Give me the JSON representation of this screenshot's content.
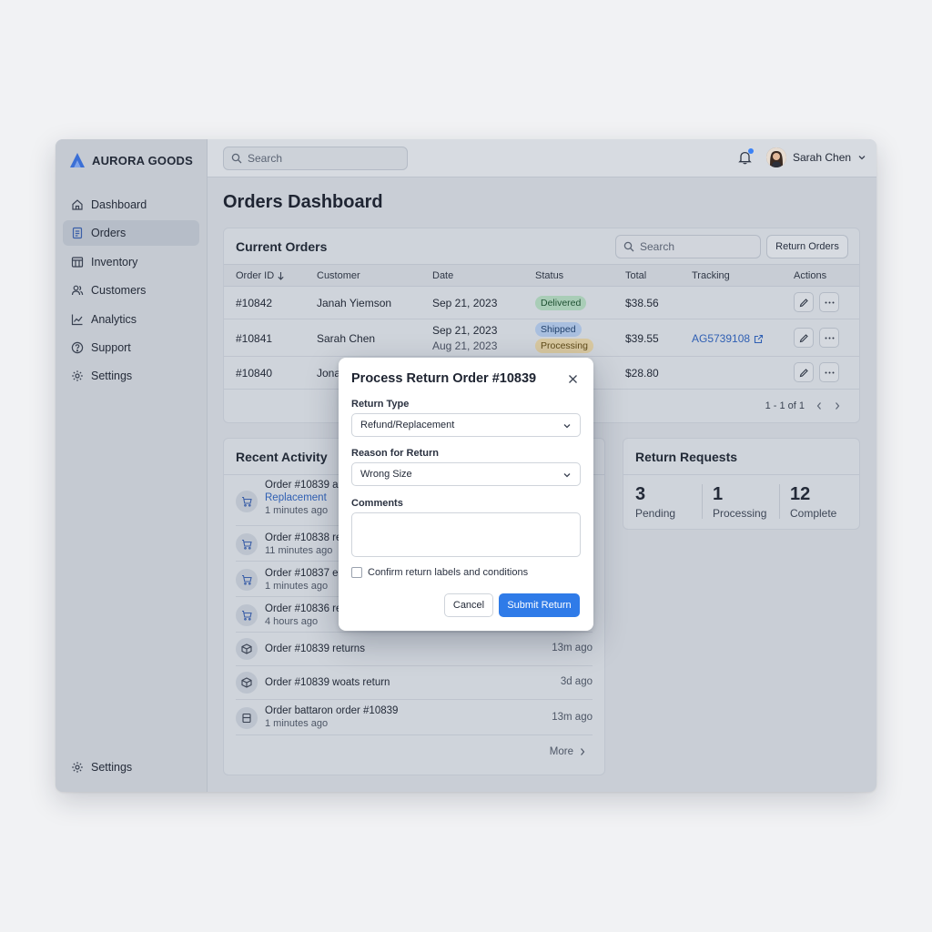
{
  "brand": {
    "name": "AURORA GOODS",
    "accent": "#3b6fd6"
  },
  "sidebar": {
    "items": [
      {
        "label": "Dashboard",
        "icon": "home-icon"
      },
      {
        "label": "Orders",
        "icon": "document-icon",
        "active": true
      },
      {
        "label": "Inventory",
        "icon": "inventory-icon"
      },
      {
        "label": "Customers",
        "icon": "users-icon"
      },
      {
        "label": "Analytics",
        "icon": "chart-icon"
      },
      {
        "label": "Support",
        "icon": "help-icon"
      },
      {
        "label": "Settings",
        "icon": "gear-icon"
      }
    ],
    "bottom": {
      "label": "Settings",
      "icon": "gear-icon"
    }
  },
  "topbar": {
    "search_placeholder": "Search",
    "user_name": "Sarah Chen"
  },
  "page": {
    "title": "Orders Dashboard"
  },
  "orders": {
    "title": "Current Orders",
    "search_placeholder": "Search",
    "return_orders_label": "Return Orders",
    "columns": [
      "Order ID",
      "Customer",
      "Date",
      "Status",
      "Total",
      "Tracking",
      "Actions"
    ],
    "rows": [
      {
        "id": "#10842",
        "customer": "Janah Yiemson",
        "date": "Sep 21, 2023",
        "date2": "",
        "status": "Delivered",
        "status2": "",
        "total": "$38.56",
        "tracking": ""
      },
      {
        "id": "#10841",
        "customer": "Sarah Chen",
        "date": "Sep 21, 2023",
        "date2": "Aug 21, 2023",
        "status": "Shipped",
        "status2": "Processing",
        "total": "$39.55",
        "tracking": "AG5739108"
      },
      {
        "id": "#10840",
        "customer": "Jona",
        "date": "",
        "date2": "",
        "status": "",
        "status2": "",
        "total": "$28.80",
        "tracking": ""
      }
    ],
    "pagination": "1 - 1 of 1"
  },
  "activity": {
    "title": "Recent Activity",
    "items": [
      {
        "title": "Order #10839 a",
        "link": "Replacement",
        "sub": "1 minutes ago",
        "time": ""
      },
      {
        "title": "Order #10838 re",
        "link": "",
        "sub": "11 minutes ago",
        "time": ""
      },
      {
        "title": "Order #10837 e",
        "link": "",
        "sub": "1 minutes ago",
        "time": ""
      },
      {
        "title": "Order #10836 re",
        "link": "",
        "sub": "4 hours ago",
        "time": ""
      },
      {
        "title": "Order #10839 returns",
        "link": "",
        "sub": "",
        "time": "13m ago"
      },
      {
        "title": "Order #10839 woats return",
        "link": "",
        "sub": "",
        "time": "3d ago"
      },
      {
        "title": "Order battaron order #10839",
        "link": "",
        "sub": "1 minutes ago",
        "time": "13m ago"
      }
    ],
    "more_label": "More"
  },
  "returns": {
    "title": "Return Requests",
    "stats": [
      {
        "value": "3",
        "label": "Pending"
      },
      {
        "value": "1",
        "label": "Processing"
      },
      {
        "value": "12",
        "label": "Complete"
      }
    ]
  },
  "modal": {
    "title": "Process Return Order #10839",
    "return_type_label": "Return Type",
    "return_type_value": "Refund/Replacement",
    "reason_label": "Reason for Return",
    "reason_value": "Wrong Size",
    "comments_label": "Comments",
    "comments_value": "",
    "confirm_label": "Confirm return labels and conditions",
    "cancel_label": "Cancel",
    "submit_label": "Submit Return",
    "submit_color": "#2f7be8"
  }
}
